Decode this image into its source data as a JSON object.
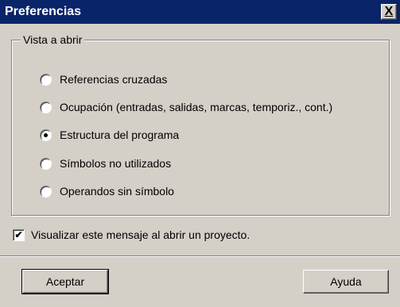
{
  "window": {
    "title": "Preferencias",
    "close_glyph": "X"
  },
  "group": {
    "legend": "Vista a abrir",
    "options": [
      {
        "label": "Referencias cruzadas",
        "checked": false
      },
      {
        "label": "Ocupación (entradas, salidas, marcas, temporiz., cont.)",
        "checked": false
      },
      {
        "label": "Estructura del programa",
        "checked": true
      },
      {
        "label": "Símbolos no utilizados",
        "checked": false
      },
      {
        "label": "Operandos sin símbolo",
        "checked": false
      }
    ]
  },
  "show_message": {
    "label": "Visualizar este mensaje al abrir un proyecto.",
    "checked": true,
    "check_glyph": "✔"
  },
  "buttons": {
    "ok_label": "Aceptar",
    "help_label": "Ayuda"
  }
}
